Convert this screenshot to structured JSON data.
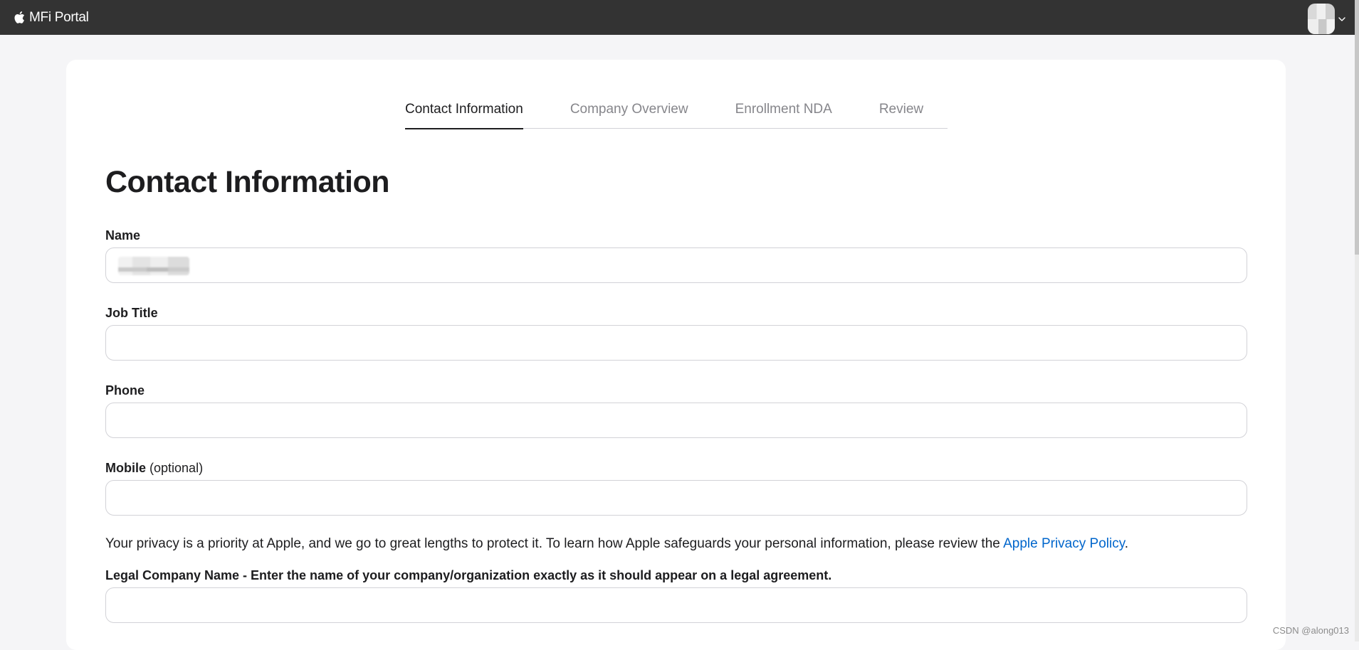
{
  "topbar": {
    "brand_name": "MFi Portal",
    "logo_icon": "apple-logo-icon",
    "account_icon": "chevron-down-icon"
  },
  "tabs": [
    {
      "label": "Contact Information",
      "active": true
    },
    {
      "label": "Company Overview",
      "active": false
    },
    {
      "label": "Enrollment NDA",
      "active": false
    },
    {
      "label": "Review",
      "active": false
    }
  ],
  "page": {
    "title": "Contact Information"
  },
  "form": {
    "name": {
      "label": "Name",
      "value": ""
    },
    "job_title": {
      "label": "Job Title",
      "value": ""
    },
    "phone": {
      "label": "Phone",
      "value": ""
    },
    "mobile": {
      "label": "Mobile",
      "optional_note": "(optional)",
      "value": ""
    },
    "privacy": {
      "text": "Your privacy is a priority at Apple, and we go to great lengths to protect it. To learn how Apple safeguards your personal information, please review the ",
      "link_text": "Apple Privacy Policy",
      "suffix": "."
    },
    "legal_company_name": {
      "label": "Legal Company Name - Enter the name of your company/organization exactly as it should appear on a legal agreement.",
      "value": ""
    }
  },
  "watermark": "CSDN @along013",
  "colors": {
    "topbar_bg": "#333333",
    "page_bg": "#f5f5f7",
    "link": "#0066cc",
    "inactive_tab": "#86868b"
  }
}
